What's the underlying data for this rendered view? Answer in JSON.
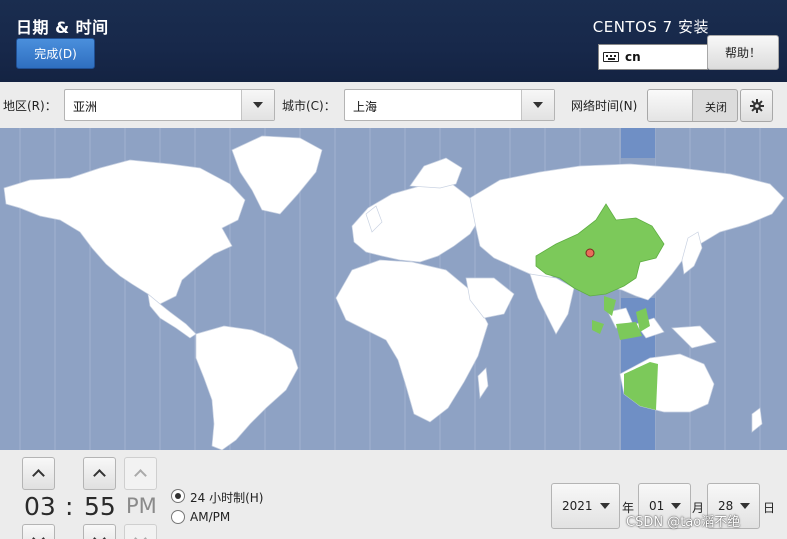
{
  "header": {
    "page_title": "日期 & 时间",
    "done_label": "完成(D)",
    "product_title": "CENTOS 7 安装",
    "keyboard_layout": "cn",
    "help_label": "帮助！"
  },
  "toolbar": {
    "region_label": "地区(R)：",
    "region_value": "亚洲",
    "city_label": "城市(C)：",
    "city_value": "上海",
    "network_time_label": "网络时间(N)",
    "network_time_state": "关闭"
  },
  "map": {
    "selected_city_marker": "Shanghai",
    "colors": {
      "ocean": "#8ea2c4",
      "land": "#ffffff",
      "selected_zone": "#7cc95a",
      "selected_band": "#6f8fc5"
    }
  },
  "time": {
    "hour": "03",
    "separator": ":",
    "minute": "55",
    "ampm": "PM",
    "format_24h_label": "24 小时制(H)",
    "format_ampm_label": "AM/PM",
    "format_24h_selected": true
  },
  "date": {
    "year": "2021",
    "year_unit": "年",
    "month": "01",
    "month_unit": "月",
    "day": "28",
    "day_unit": "日"
  },
  "watermark": "CSDN @tao滔不绝",
  "colors": {
    "header_bg": "#17284a",
    "primary_button": "#3a7fd0"
  }
}
